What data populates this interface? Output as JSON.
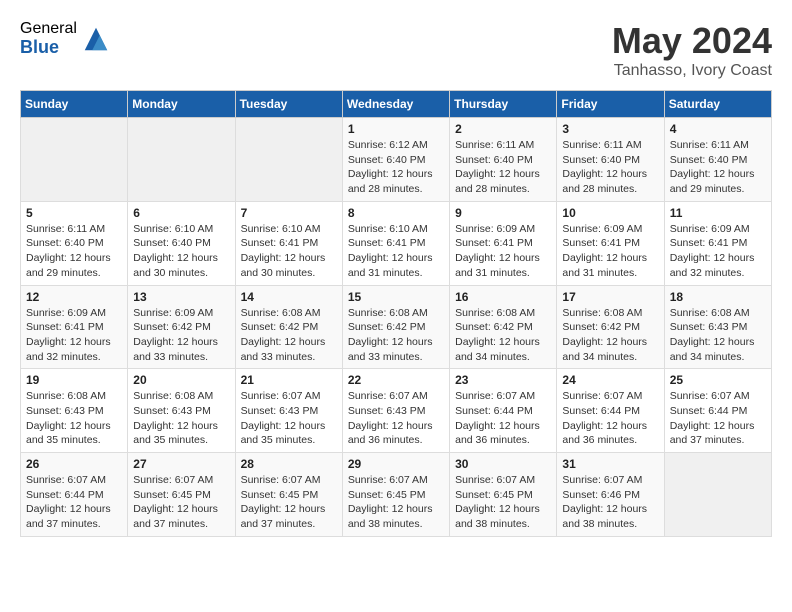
{
  "logo": {
    "general": "General",
    "blue": "Blue"
  },
  "title": "May 2024",
  "subtitle": "Tanhasso, Ivory Coast",
  "days_header": [
    "Sunday",
    "Monday",
    "Tuesday",
    "Wednesday",
    "Thursday",
    "Friday",
    "Saturday"
  ],
  "weeks": [
    [
      {
        "day": "",
        "info": ""
      },
      {
        "day": "",
        "info": ""
      },
      {
        "day": "",
        "info": ""
      },
      {
        "day": "1",
        "info": "Sunrise: 6:12 AM\nSunset: 6:40 PM\nDaylight: 12 hours\nand 28 minutes."
      },
      {
        "day": "2",
        "info": "Sunrise: 6:11 AM\nSunset: 6:40 PM\nDaylight: 12 hours\nand 28 minutes."
      },
      {
        "day": "3",
        "info": "Sunrise: 6:11 AM\nSunset: 6:40 PM\nDaylight: 12 hours\nand 28 minutes."
      },
      {
        "day": "4",
        "info": "Sunrise: 6:11 AM\nSunset: 6:40 PM\nDaylight: 12 hours\nand 29 minutes."
      }
    ],
    [
      {
        "day": "5",
        "info": "Sunrise: 6:11 AM\nSunset: 6:40 PM\nDaylight: 12 hours\nand 29 minutes."
      },
      {
        "day": "6",
        "info": "Sunrise: 6:10 AM\nSunset: 6:40 PM\nDaylight: 12 hours\nand 30 minutes."
      },
      {
        "day": "7",
        "info": "Sunrise: 6:10 AM\nSunset: 6:41 PM\nDaylight: 12 hours\nand 30 minutes."
      },
      {
        "day": "8",
        "info": "Sunrise: 6:10 AM\nSunset: 6:41 PM\nDaylight: 12 hours\nand 31 minutes."
      },
      {
        "day": "9",
        "info": "Sunrise: 6:09 AM\nSunset: 6:41 PM\nDaylight: 12 hours\nand 31 minutes."
      },
      {
        "day": "10",
        "info": "Sunrise: 6:09 AM\nSunset: 6:41 PM\nDaylight: 12 hours\nand 31 minutes."
      },
      {
        "day": "11",
        "info": "Sunrise: 6:09 AM\nSunset: 6:41 PM\nDaylight: 12 hours\nand 32 minutes."
      }
    ],
    [
      {
        "day": "12",
        "info": "Sunrise: 6:09 AM\nSunset: 6:41 PM\nDaylight: 12 hours\nand 32 minutes."
      },
      {
        "day": "13",
        "info": "Sunrise: 6:09 AM\nSunset: 6:42 PM\nDaylight: 12 hours\nand 33 minutes."
      },
      {
        "day": "14",
        "info": "Sunrise: 6:08 AM\nSunset: 6:42 PM\nDaylight: 12 hours\nand 33 minutes."
      },
      {
        "day": "15",
        "info": "Sunrise: 6:08 AM\nSunset: 6:42 PM\nDaylight: 12 hours\nand 33 minutes."
      },
      {
        "day": "16",
        "info": "Sunrise: 6:08 AM\nSunset: 6:42 PM\nDaylight: 12 hours\nand 34 minutes."
      },
      {
        "day": "17",
        "info": "Sunrise: 6:08 AM\nSunset: 6:42 PM\nDaylight: 12 hours\nand 34 minutes."
      },
      {
        "day": "18",
        "info": "Sunrise: 6:08 AM\nSunset: 6:43 PM\nDaylight: 12 hours\nand 34 minutes."
      }
    ],
    [
      {
        "day": "19",
        "info": "Sunrise: 6:08 AM\nSunset: 6:43 PM\nDaylight: 12 hours\nand 35 minutes."
      },
      {
        "day": "20",
        "info": "Sunrise: 6:08 AM\nSunset: 6:43 PM\nDaylight: 12 hours\nand 35 minutes."
      },
      {
        "day": "21",
        "info": "Sunrise: 6:07 AM\nSunset: 6:43 PM\nDaylight: 12 hours\nand 35 minutes."
      },
      {
        "day": "22",
        "info": "Sunrise: 6:07 AM\nSunset: 6:43 PM\nDaylight: 12 hours\nand 36 minutes."
      },
      {
        "day": "23",
        "info": "Sunrise: 6:07 AM\nSunset: 6:44 PM\nDaylight: 12 hours\nand 36 minutes."
      },
      {
        "day": "24",
        "info": "Sunrise: 6:07 AM\nSunset: 6:44 PM\nDaylight: 12 hours\nand 36 minutes."
      },
      {
        "day": "25",
        "info": "Sunrise: 6:07 AM\nSunset: 6:44 PM\nDaylight: 12 hours\nand 37 minutes."
      }
    ],
    [
      {
        "day": "26",
        "info": "Sunrise: 6:07 AM\nSunset: 6:44 PM\nDaylight: 12 hours\nand 37 minutes."
      },
      {
        "day": "27",
        "info": "Sunrise: 6:07 AM\nSunset: 6:45 PM\nDaylight: 12 hours\nand 37 minutes."
      },
      {
        "day": "28",
        "info": "Sunrise: 6:07 AM\nSunset: 6:45 PM\nDaylight: 12 hours\nand 37 minutes."
      },
      {
        "day": "29",
        "info": "Sunrise: 6:07 AM\nSunset: 6:45 PM\nDaylight: 12 hours\nand 38 minutes."
      },
      {
        "day": "30",
        "info": "Sunrise: 6:07 AM\nSunset: 6:45 PM\nDaylight: 12 hours\nand 38 minutes."
      },
      {
        "day": "31",
        "info": "Sunrise: 6:07 AM\nSunset: 6:46 PM\nDaylight: 12 hours\nand 38 minutes."
      },
      {
        "day": "",
        "info": ""
      }
    ]
  ]
}
